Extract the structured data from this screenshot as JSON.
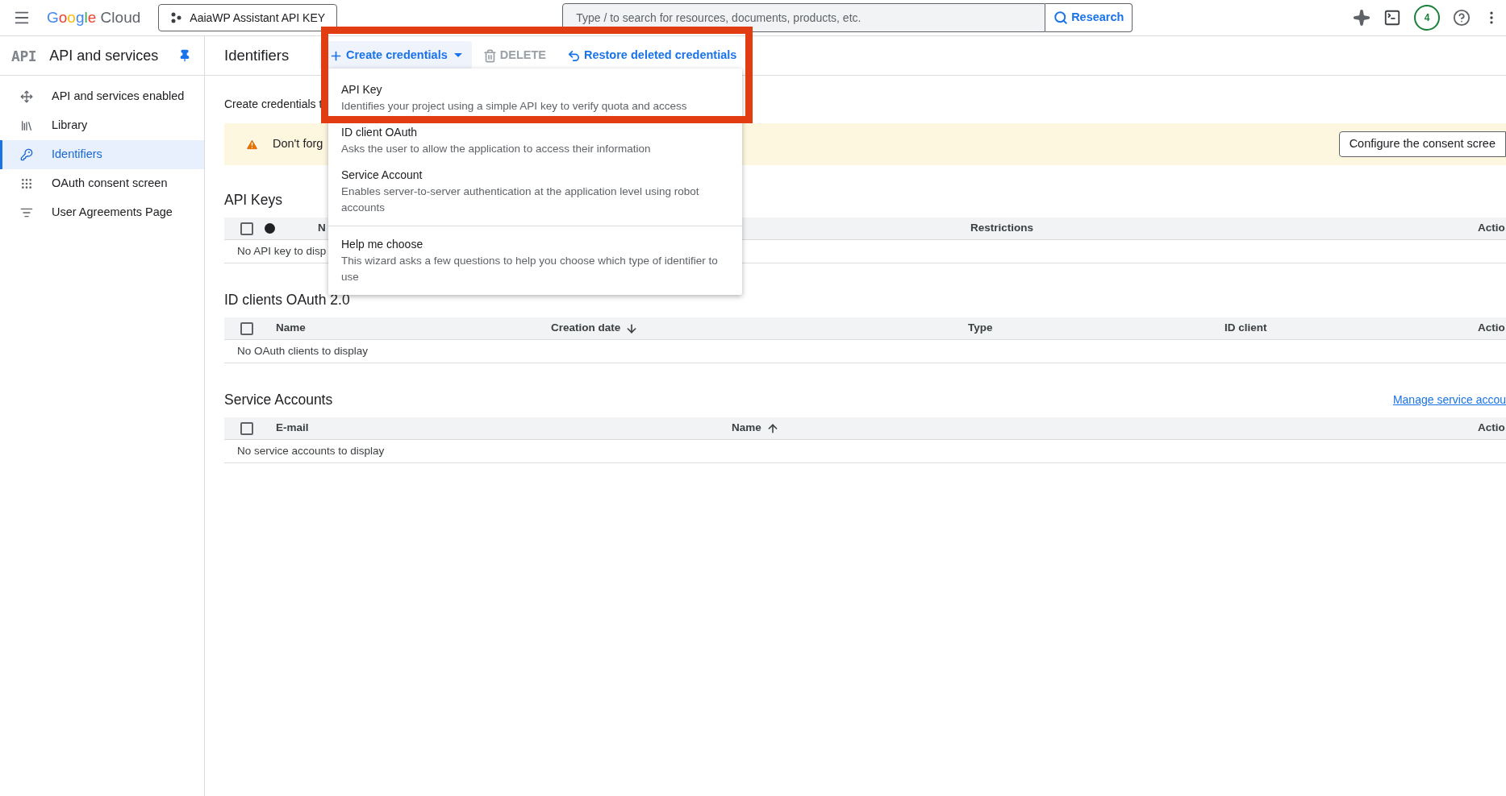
{
  "header": {
    "product": "Google Cloud",
    "project": "AaiaWP Assistant API KEY",
    "search": {
      "placeholder": "Type / to search for resources, documents, products, etc."
    },
    "search_button": "Research",
    "notifications": "4"
  },
  "sidebar": {
    "logo": "API",
    "title": "API and services",
    "pinned": true,
    "items": [
      {
        "label": "API and services enabled",
        "selected": false
      },
      {
        "label": "Library",
        "selected": false
      },
      {
        "label": "Identifiers",
        "selected": true
      },
      {
        "label": "OAuth consent screen",
        "selected": false
      },
      {
        "label": "User Agreements Page",
        "selected": false
      }
    ]
  },
  "page": {
    "title": "Identifiers",
    "toolbar": [
      {
        "label": "Create credentials",
        "kind": "create",
        "disabled": false
      },
      {
        "label": "DELETE",
        "kind": "delete",
        "disabled": true
      },
      {
        "label": "Restore deleted credentials",
        "kind": "restore",
        "disabled": false
      }
    ]
  },
  "intro": "Create credentials t",
  "banner": {
    "text": "Don't forg",
    "button": "Configure the consent scree"
  },
  "sections": [
    {
      "title": "API Keys",
      "select_all_checked": false,
      "columns": [
        {
          "kind": "status"
        },
        {
          "kind": "text",
          "label": "N",
          "sorted": false
        },
        {
          "kind": "text",
          "label": "Restrictions",
          "sorted": false
        },
        {
          "kind": "text",
          "label": "Actio",
          "sorted": false
        }
      ],
      "empty": "No API key to disp"
    },
    {
      "title": "ID clients OAuth 2.0",
      "select_all_checked": false,
      "columns": [
        {
          "kind": "text",
          "label": "Name",
          "sorted": false
        },
        {
          "kind": "text",
          "label": "Creation date",
          "sorted": true,
          "descending": true
        },
        {
          "kind": "text",
          "label": "Type",
          "sorted": false
        },
        {
          "kind": "text",
          "label": "ID client",
          "sorted": false
        },
        {
          "kind": "text",
          "label": "Actio",
          "sorted": false
        }
      ],
      "empty": "No OAuth clients to display"
    },
    {
      "title": "Service Accounts",
      "select_all_checked": false,
      "link": "Manage service accou",
      "columns": [
        {
          "kind": "text",
          "label": "E-mail",
          "sorted": false
        },
        {
          "kind": "text",
          "label": "Name",
          "sorted": true,
          "descending": false
        },
        {
          "kind": "text",
          "label": "Actio",
          "sorted": false
        }
      ],
      "empty": "No service accounts to display"
    }
  ],
  "highlight_frame": true,
  "menu": {
    "items": [
      {
        "title": "API Key",
        "description": "Identifies your project using a simple API key to verify quota and access"
      },
      {
        "title": "ID client OAuth",
        "description": "Asks the user to allow the application to access their information"
      },
      {
        "title": "Service Account",
        "description": "Enables server-to-server authentication at the application level using robot accounts"
      }
    ],
    "footer_item": {
      "title": "Help me choose",
      "description": "This wizard asks a few questions to help you choose which type of identifier to use"
    }
  }
}
